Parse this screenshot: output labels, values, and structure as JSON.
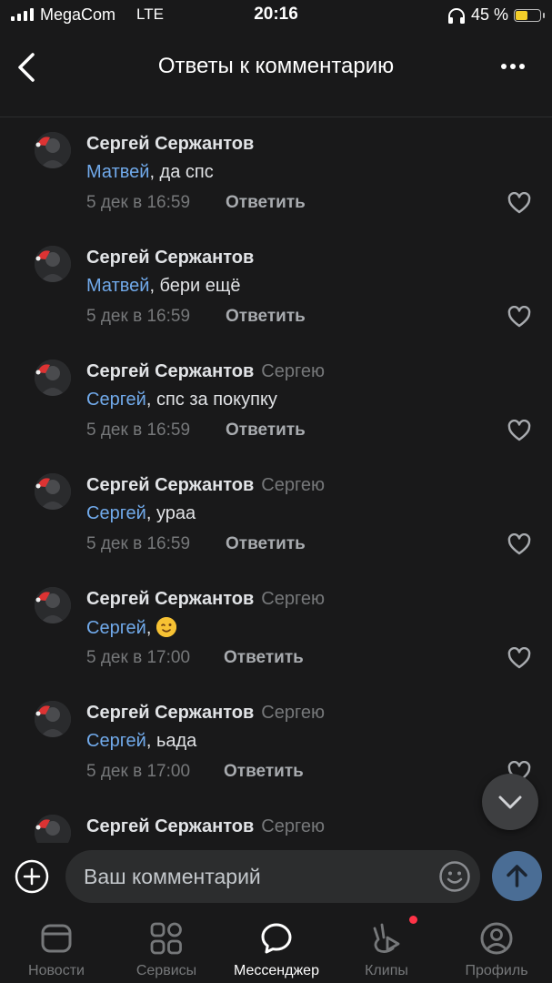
{
  "status_bar": {
    "carrier": "MegaCom",
    "network": "LTE",
    "time": "20:16",
    "battery": "45 %",
    "battery_level": 0.45
  },
  "header": {
    "title": "Ответы к комментарию",
    "back_icon": "chevron-left-icon",
    "more_icon": "more-horizontal-icon"
  },
  "comments": [
    {
      "author": "Сергей Сержантов",
      "reply_to": "",
      "mention": "Матвей",
      "text": ", да спс",
      "time": "5 дек в 16:59",
      "reply_label": "Ответить",
      "emoji": false
    },
    {
      "author": "Сергей Сержантов",
      "reply_to": "",
      "mention": "Матвей",
      "text": ", бери ещё",
      "time": "5 дек в 16:59",
      "reply_label": "Ответить",
      "emoji": false
    },
    {
      "author": "Сергей Сержантов",
      "reply_to": "Сергею",
      "mention": "Сергей",
      "text": ", спс за покупку",
      "time": "5 дек в 16:59",
      "reply_label": "Ответить",
      "emoji": false
    },
    {
      "author": "Сергей Сержантов",
      "reply_to": "Сергею",
      "mention": "Сергей",
      "text": ", ураа",
      "time": "5 дек в 16:59",
      "reply_label": "Ответить",
      "emoji": false
    },
    {
      "author": "Сергей Сержантов",
      "reply_to": "Сергею",
      "mention": "Сергей",
      "text": ", ",
      "time": "5 дек в 17:00",
      "reply_label": "Ответить",
      "emoji": true
    },
    {
      "author": "Сергей Сержантов",
      "reply_to": "Сергею",
      "mention": "Сергей",
      "text": ", ьада",
      "time": "5 дек в 17:00",
      "reply_label": "Ответить",
      "emoji": false
    },
    {
      "author": "Сергей Сержантов",
      "reply_to": "Сергею",
      "mention": "",
      "text": "",
      "time": "",
      "reply_label": "",
      "emoji": false
    }
  ],
  "composer": {
    "placeholder": "Ваш комментарий"
  },
  "tabs": [
    {
      "label": "Новости",
      "icon": "news-icon",
      "active": false
    },
    {
      "label": "Сервисы",
      "icon": "services-icon",
      "active": false
    },
    {
      "label": "Мессенджер",
      "icon": "messenger-icon",
      "active": true
    },
    {
      "label": "Клипы",
      "icon": "clips-icon",
      "active": false,
      "badge": true
    },
    {
      "label": "Профиль",
      "icon": "profile-icon",
      "active": false
    }
  ],
  "colors": {
    "background": "#19191a",
    "mention": "#71aaeb",
    "secondary": "#76787a",
    "send": "#4a6d95",
    "badge": "#ff3347"
  }
}
